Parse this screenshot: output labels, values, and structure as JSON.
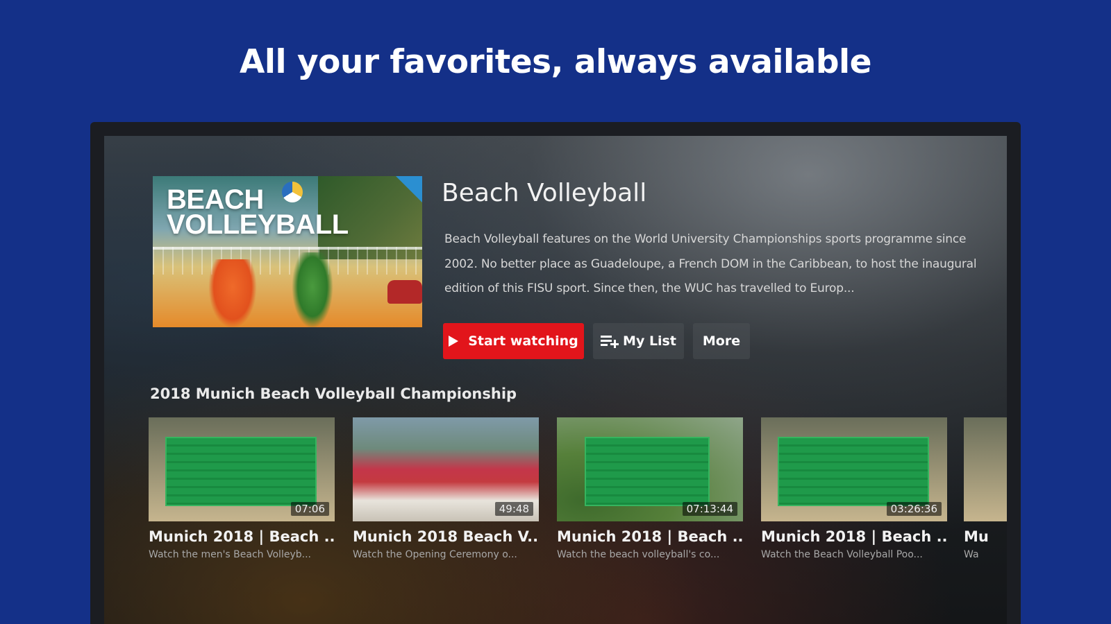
{
  "headline": "All your favorites, always available",
  "hero": {
    "thumbnail_text": [
      "BEACH",
      "VOLLEYBALL"
    ],
    "title": "Beach Volleyball",
    "description": "Beach Volleyball features on the World University Championships sports programme since 2002. No better place as Guadeloupe, a French DOM in the Caribbean, to host the inaugural edition of this FISU sport. Since then, the WUC has travelled to Europ...",
    "buttons": {
      "start": "Start watching",
      "mylist": "My List",
      "more": "More"
    }
  },
  "row": {
    "title": "2018 Munich Beach Volleyball Championship",
    "cards": [
      {
        "title": "Munich 2018 | Beach ...",
        "subtitle": "Watch the men's Beach Volleyb...",
        "duration": "07:06"
      },
      {
        "title": "Munich 2018 Beach V...",
        "subtitle": "Watch the Opening Ceremony o...",
        "duration": "49:48"
      },
      {
        "title": "Munich 2018 | Beach ...",
        "subtitle": "Watch the beach volleyball's co...",
        "duration": "07:13:44"
      },
      {
        "title": "Munich 2018 | Beach ...",
        "subtitle": "Watch the Beach Volleyball Poo...",
        "duration": "03:26:36"
      },
      {
        "title": "Mu",
        "subtitle": "Wa",
        "duration": ""
      }
    ]
  },
  "colors": {
    "background": "#143088",
    "start_button": "#e2151b"
  }
}
